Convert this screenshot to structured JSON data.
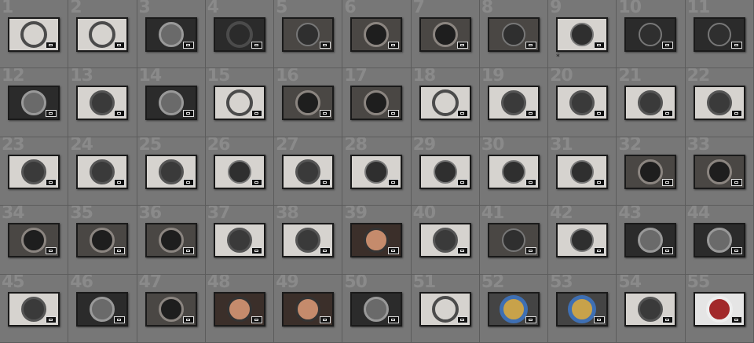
{
  "grid": {
    "columns": 11,
    "cells": [
      {
        "index": "1",
        "theme": "t-light t-ring",
        "flag": ""
      },
      {
        "index": "2",
        "theme": "t-light t-ring",
        "flag": ""
      },
      {
        "index": "3",
        "theme": "t-dark",
        "flag": ""
      },
      {
        "index": "4",
        "theme": "t-dark t-ring",
        "flag": ""
      },
      {
        "index": "5",
        "theme": "t-bench t-rod",
        "flag": ""
      },
      {
        "index": "6",
        "theme": "t-bench",
        "flag": ""
      },
      {
        "index": "7",
        "theme": "t-bench",
        "flag": ""
      },
      {
        "index": "8",
        "theme": "t-bench t-rod",
        "flag": ""
      },
      {
        "index": "9",
        "theme": "t-light t-rod",
        "flag": "*"
      },
      {
        "index": "10",
        "theme": "t-dark t-rod",
        "flag": ""
      },
      {
        "index": "11",
        "theme": "t-dark t-rod",
        "flag": ""
      },
      {
        "index": "12",
        "theme": "t-dark",
        "flag": ""
      },
      {
        "index": "13",
        "theme": "t-light",
        "flag": ""
      },
      {
        "index": "14",
        "theme": "t-dark",
        "flag": ""
      },
      {
        "index": "15",
        "theme": "t-light t-ring",
        "flag": ""
      },
      {
        "index": "16",
        "theme": "t-bench",
        "flag": ""
      },
      {
        "index": "17",
        "theme": "t-bench",
        "flag": ""
      },
      {
        "index": "18",
        "theme": "t-light t-ring",
        "flag": ""
      },
      {
        "index": "19",
        "theme": "t-light",
        "flag": ""
      },
      {
        "index": "20",
        "theme": "t-light",
        "flag": ""
      },
      {
        "index": "21",
        "theme": "t-light",
        "flag": ""
      },
      {
        "index": "22",
        "theme": "t-light",
        "flag": ""
      },
      {
        "index": "23",
        "theme": "t-light",
        "flag": ""
      },
      {
        "index": "24",
        "theme": "t-light",
        "flag": ""
      },
      {
        "index": "25",
        "theme": "t-light",
        "flag": ""
      },
      {
        "index": "26",
        "theme": "t-light t-rod",
        "flag": ""
      },
      {
        "index": "27",
        "theme": "t-light",
        "flag": ""
      },
      {
        "index": "28",
        "theme": "t-light t-rod",
        "flag": ""
      },
      {
        "index": "29",
        "theme": "t-light t-rod",
        "flag": ""
      },
      {
        "index": "30",
        "theme": "t-light t-rod",
        "flag": ""
      },
      {
        "index": "31",
        "theme": "t-light t-rod",
        "flag": ""
      },
      {
        "index": "32",
        "theme": "t-bench",
        "flag": ""
      },
      {
        "index": "33",
        "theme": "t-bench",
        "flag": ""
      },
      {
        "index": "34",
        "theme": "t-bench",
        "flag": ""
      },
      {
        "index": "35",
        "theme": "t-bench",
        "flag": ""
      },
      {
        "index": "36",
        "theme": "t-bench",
        "flag": ""
      },
      {
        "index": "37",
        "theme": "t-light",
        "flag": ""
      },
      {
        "index": "38",
        "theme": "t-light",
        "flag": ""
      },
      {
        "index": "39",
        "theme": "t-hand",
        "flag": ""
      },
      {
        "index": "40",
        "theme": "t-light",
        "flag": ""
      },
      {
        "index": "41",
        "theme": "t-bench t-rod",
        "flag": ""
      },
      {
        "index": "42",
        "theme": "t-light t-rod",
        "flag": ""
      },
      {
        "index": "43",
        "theme": "t-dark",
        "flag": ""
      },
      {
        "index": "44",
        "theme": "t-dark",
        "flag": ""
      },
      {
        "index": "45",
        "theme": "t-light",
        "flag": ""
      },
      {
        "index": "46",
        "theme": "t-dark",
        "flag": ""
      },
      {
        "index": "47",
        "theme": "t-bench",
        "flag": ""
      },
      {
        "index": "48",
        "theme": "t-hand",
        "flag": ""
      },
      {
        "index": "49",
        "theme": "t-hand",
        "flag": ""
      },
      {
        "index": "50",
        "theme": "t-dark",
        "flag": ""
      },
      {
        "index": "51",
        "theme": "t-light t-ring",
        "flag": ""
      },
      {
        "index": "52",
        "theme": "t-filter",
        "flag": ""
      },
      {
        "index": "53",
        "theme": "t-filter",
        "flag": ""
      },
      {
        "index": "54",
        "theme": "t-light",
        "flag": ""
      },
      {
        "index": "55",
        "theme": "t-red",
        "flag": ""
      }
    ]
  }
}
